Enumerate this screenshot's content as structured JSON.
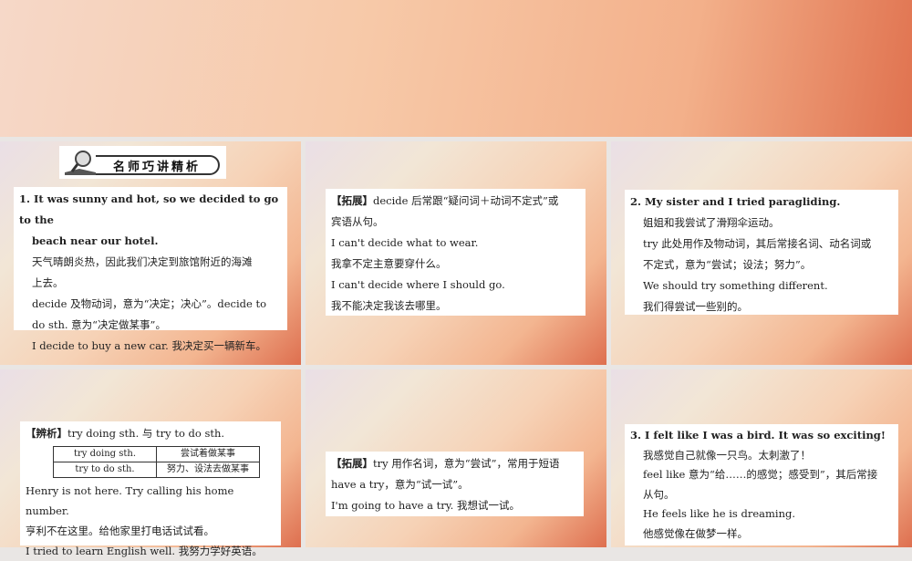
{
  "header_banner": "名师巧讲精析",
  "slide1": {
    "lines": [
      "1. It was sunny and hot, so we decided to go to the",
      "beach near our hotel.",
      "天气晴朗炎热，因此我们决定到旅馆附近的海滩",
      "上去。",
      "decide 及物动词，意为“决定；决心”。decide to",
      "do sth. 意为“决定做某事”。",
      "I decide to buy a new car. 我决定买一辆新车。"
    ]
  },
  "slide2": {
    "tag": "【拓展】",
    "lines": [
      "decide 后常跟“疑问词＋动词不定式”或",
      "宾语从句。",
      "I can't decide what to wear.",
      "我拿不定主意要穿什么。",
      "I can't decide where I should go.",
      "我不能决定我该去哪里。"
    ]
  },
  "slide3": {
    "lines": [
      "2. My sister and I tried paragliding.",
      "姐姐和我尝试了滑翔伞运动。",
      "try 此处用作及物动词，其后常接名词、动名词或",
      "不定式，意为“尝试；设法；努力”。",
      "We should try something different.",
      "我们得尝试一些别的。"
    ]
  },
  "slide4": {
    "tag": "【辨析】",
    "intro": "try doing sth. 与 try to do sth.",
    "table": [
      [
        "try doing sth.",
        "尝试着做某事"
      ],
      [
        "try to do sth.",
        "努力、设法去做某事"
      ]
    ],
    "lines": [
      "Henry is not here. Try calling his home number.",
      "亨利不在这里。给他家里打电话试试看。",
      "I tried to learn English well. 我努力学好英语。"
    ]
  },
  "slide5": {
    "tag": "【拓展】",
    "lines": [
      "try 用作名词，意为“尝试”，常用于短语",
      "have a try，意为“试一试”。",
      "I'm going to have a try. 我想试一试。"
    ]
  },
  "slide6": {
    "lines": [
      "3. I felt like I was a bird. It was so exciting!",
      "我感觉自己就像一只鸟。太刺激了！",
      "feel like 意为“给……的感觉；感受到”，其后常接",
      "从句。",
      "He feels like he is dreaming.",
      "他感觉像在做梦一样。"
    ]
  }
}
